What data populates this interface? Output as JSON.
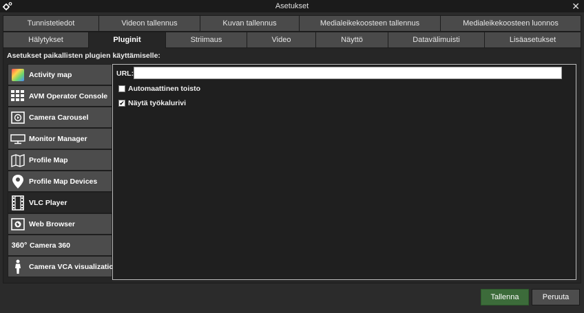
{
  "window": {
    "title": "Asetukset",
    "close_glyph": "✕",
    "settings_icon": "gear-icon"
  },
  "tabs": {
    "row1": [
      {
        "label": "Tunnistetiedot"
      },
      {
        "label": "Videon tallennus"
      },
      {
        "label": "Kuvan tallennus"
      },
      {
        "label": "Medialeikekoosteen tallennus"
      },
      {
        "label": "Medialeikekoosteen luonnos"
      }
    ],
    "row2": [
      {
        "label": "Hälytykset"
      },
      {
        "label": "Pluginit",
        "active": true
      },
      {
        "label": "Striimaus"
      },
      {
        "label": "Video"
      },
      {
        "label": "Näyttö"
      },
      {
        "label": "Datavälimuisti"
      },
      {
        "label": "Lisäasetukset"
      }
    ]
  },
  "panel": {
    "section_label": "Asetukset paikallisten plugien käyttämiselle:"
  },
  "plugins": [
    {
      "label": "Activity map",
      "icon": "activity-map-icon"
    },
    {
      "label": "AVM Operator Console",
      "icon": "grid-icon"
    },
    {
      "label": "Camera Carousel",
      "icon": "carousel-icon"
    },
    {
      "label": "Monitor Manager",
      "icon": "monitor-icon"
    },
    {
      "label": "Profile Map",
      "icon": "map-icon"
    },
    {
      "label": "Profile Map Devices",
      "icon": "map-pin-icon"
    },
    {
      "label": "VLC Player",
      "icon": "film-icon",
      "active": true
    },
    {
      "label": "Web Browser",
      "icon": "globe-icon"
    },
    {
      "label": "Camera 360",
      "icon": "camera-360-icon",
      "icon_text": "360°"
    },
    {
      "label": "Camera VCA visualization",
      "icon": "person-icon"
    }
  ],
  "settings": {
    "url_label": "URL:",
    "url_value": "",
    "autoplay_label": "Automaattinen toisto",
    "autoplay_checked": false,
    "toolbar_label": "Näytä työkalurivi",
    "toolbar_checked": true
  },
  "buttons": {
    "save": "Tallenna",
    "cancel": "Peruuta"
  },
  "colors": {
    "accent_save": "#3c6b3a",
    "tab_bg": "#4a4a4a",
    "panel_bg": "#262626"
  }
}
